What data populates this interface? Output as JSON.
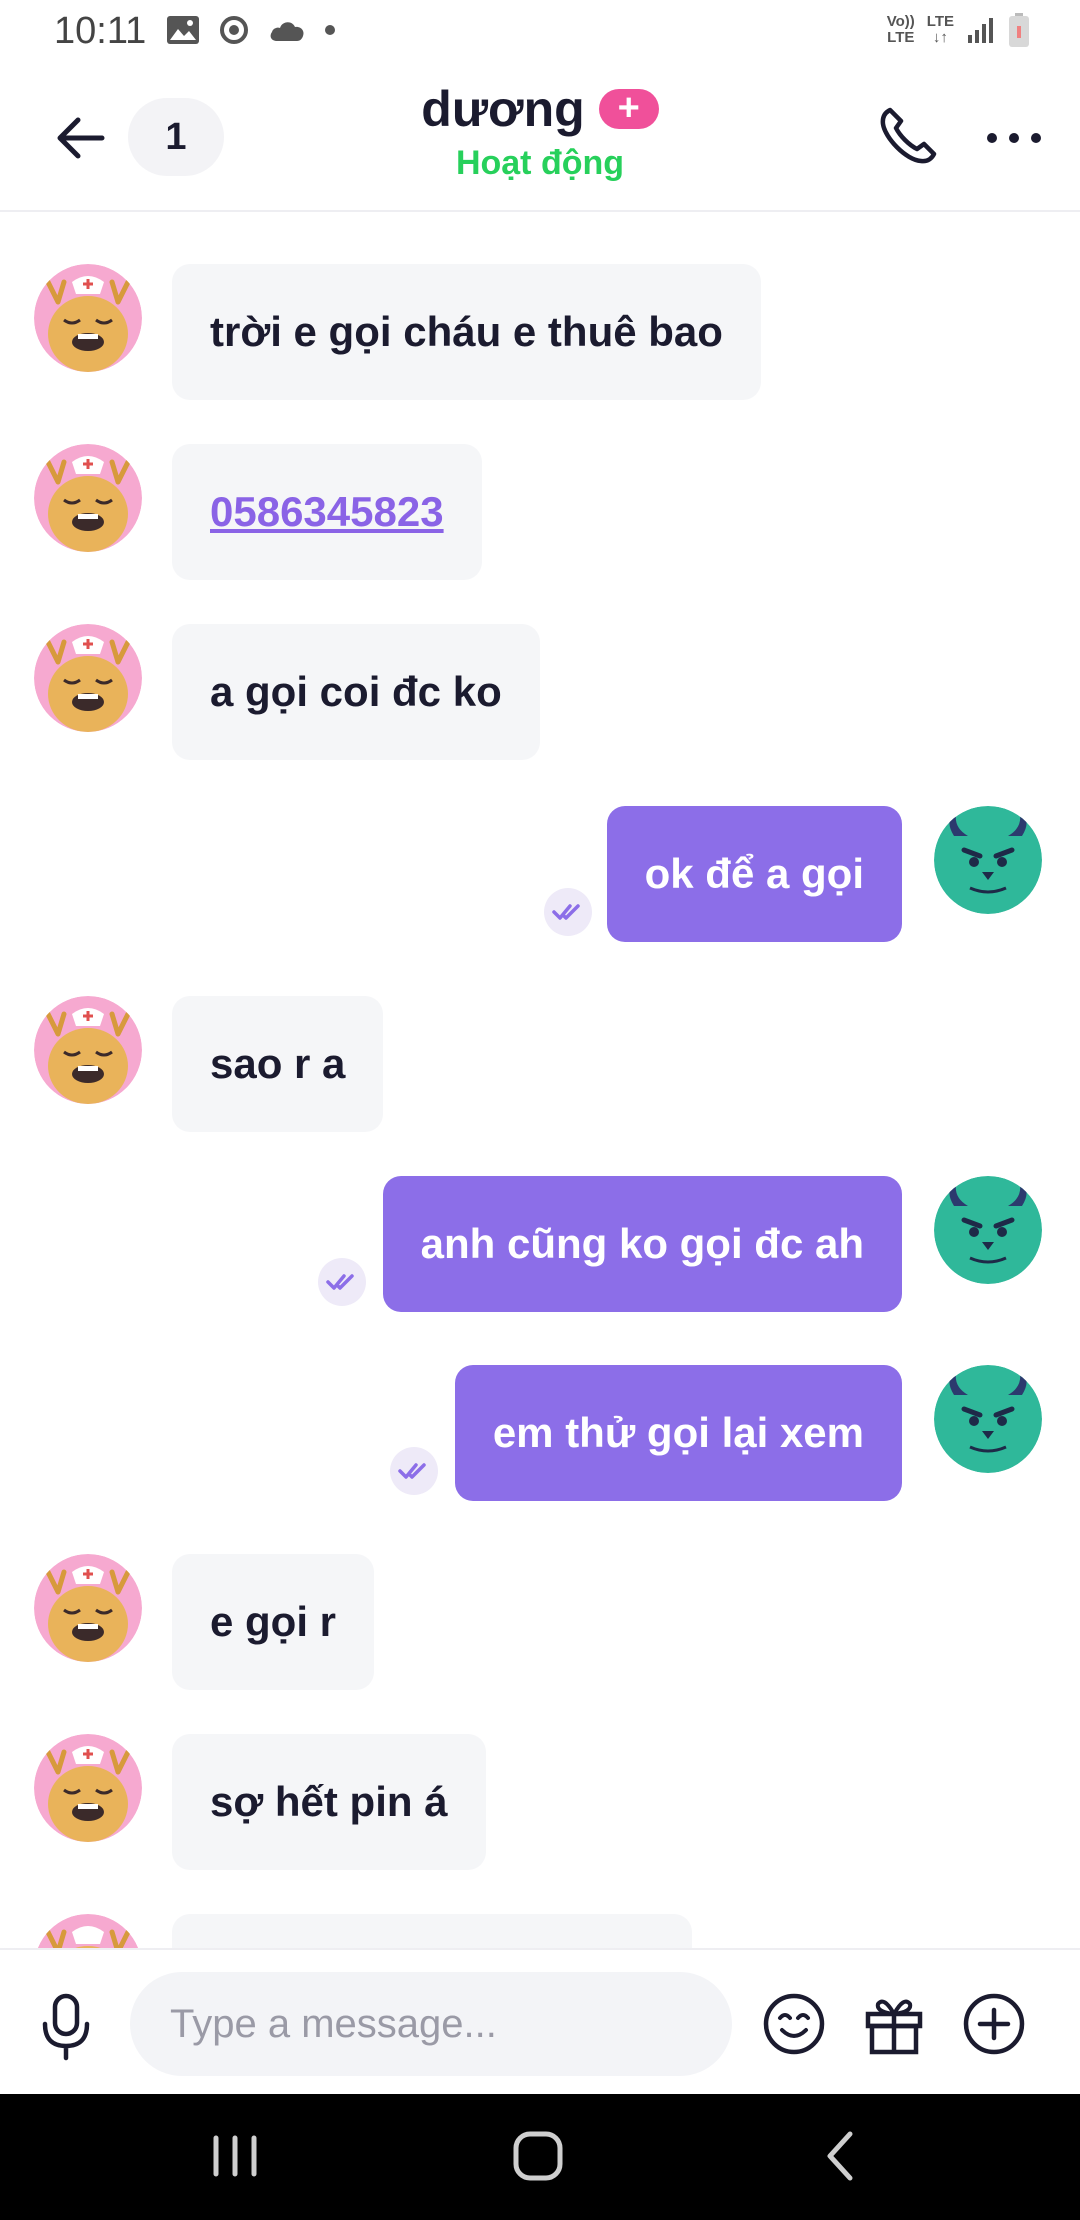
{
  "status_bar": {
    "time": "10:11",
    "volte_top": "Vo))",
    "volte_bottom": "LTE",
    "lte_label": "LTE"
  },
  "header": {
    "back_icon": "arrow-left-icon",
    "count": "1",
    "contact_name": "dương",
    "plus_badge": "+",
    "status": "Hoạt động",
    "call_icon": "phone-icon",
    "more_icon": "more-dots-icon"
  },
  "messages": [
    {
      "side": "in",
      "text": "trời e gọi cháu e thuê bao"
    },
    {
      "side": "in",
      "text": "0586345823",
      "is_link": true
    },
    {
      "side": "in",
      "text": "a gọi coi đc ko"
    },
    {
      "side": "out",
      "text": "ok để a gọi",
      "read": true
    },
    {
      "side": "in",
      "text": "sao r a"
    },
    {
      "side": "out",
      "text": "anh cũng ko gọi đc ah",
      "read": true
    },
    {
      "side": "out",
      "text": "em thử gọi lại xem",
      "read": true
    },
    {
      "side": "in",
      "text": "e gọi r"
    },
    {
      "side": "in",
      "text": "sợ hết pin á"
    }
  ],
  "composer": {
    "placeholder": "Type a message...",
    "value": "",
    "mic_icon": "microphone-icon",
    "emoji_icon": "emoji-icon",
    "gift_icon": "gift-icon",
    "plus_icon": "plus-circle-icon"
  },
  "colors": {
    "accent": "#8c6ee8",
    "online": "#27d05b",
    "badge": "#f0509a",
    "incoming_bubble": "#f5f6f8"
  }
}
